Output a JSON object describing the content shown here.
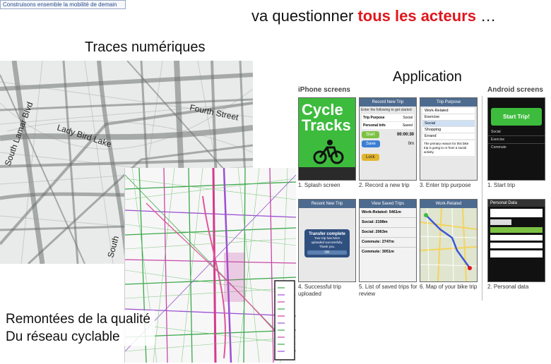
{
  "logo": {
    "text": "Construisons ensemble la mobilité de demain"
  },
  "title": {
    "prefix": "va questionner",
    "highlight": "tous les acteurs",
    "suffix": "…"
  },
  "traces_label": "Traces numériques",
  "application_label": "Application",
  "map_labels": {
    "lamar": "South Lamar Blvd",
    "lake": "Lady Bird Lake",
    "fourth": "Fourth Street",
    "south": "South"
  },
  "remontees": {
    "line1": "Remontées de la qualité",
    "line2": "Du réseau cyclable"
  },
  "screens": {
    "iphone_label": "iPhone screens",
    "android_label": "Android screens",
    "splash": {
      "title_line1": "Cycle",
      "title_line2": "Tracks"
    },
    "record": {
      "header": "Record New Trip",
      "instruction": "Enter the following to get started",
      "row1": "Trip Purpose",
      "row1_val": "Social",
      "row2": "Personal Info",
      "row2_val": "Saved",
      "timer": "00:00:30",
      "dist": "0m",
      "start": "Start",
      "save": "Save",
      "lock": "Lock"
    },
    "purpose": {
      "header": "Trip Purpose",
      "items": [
        "Work-Related",
        "Exercise",
        "Social",
        "Shopping",
        "Errand"
      ],
      "note": "The primary reason for this bike trip is going to or from a social activity."
    },
    "android_start": {
      "button": "Start Trip!",
      "rows": [
        "Social",
        "Exercise",
        "Commute"
      ]
    },
    "uploaded": {
      "header": "Recent New Trip",
      "dialog_title": "Transfer complete",
      "dialog_text": "Your trip has been uploaded successfully. Thank you.",
      "ok": "OK"
    },
    "saved": {
      "header": "View Saved Trips",
      "items": [
        "Work-Related: 5461m",
        "Social: 2198m",
        "Social: 2063m",
        "Commute: 2747m",
        "Commute: 3051m"
      ]
    },
    "map": {
      "header": "Work-Related"
    },
    "personal": {
      "header": "Personal Data"
    },
    "captions": [
      "1. Splash screen",
      "2. Record a new trip",
      "3. Enter trip purpose",
      "1. Start trip",
      "4. Successful trip uploaded",
      "5. List of saved trips for review",
      "6. Map of your bike trip",
      "2. Personal data"
    ]
  }
}
